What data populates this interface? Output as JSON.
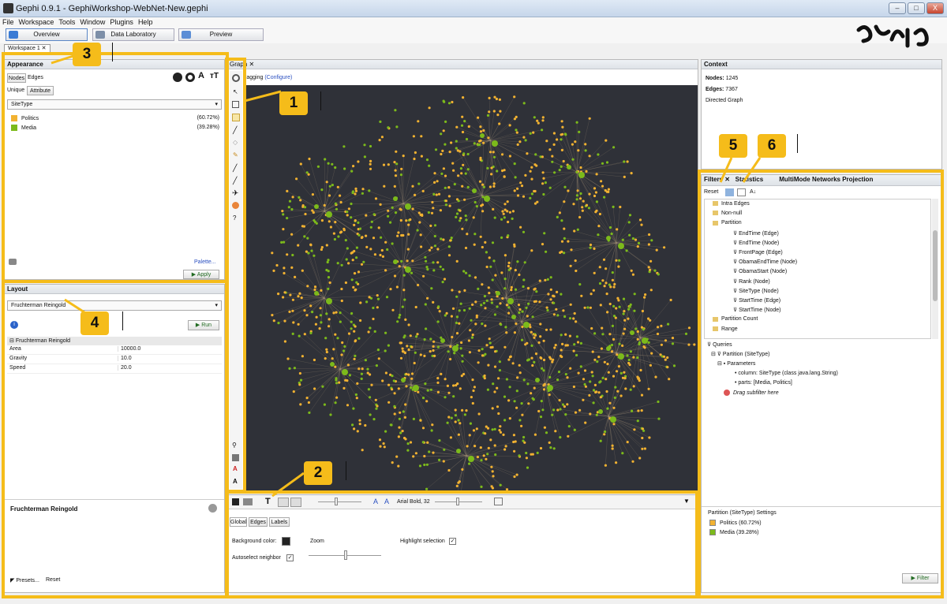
{
  "window": {
    "title": "Gephi 0.9.1 - GephiWorkshop-WebNet-New.gephi",
    "minimize": "–",
    "maximize": "□",
    "close": "X"
  },
  "menu": [
    "File",
    "Workspace",
    "Tools",
    "Window",
    "Plugins",
    "Help"
  ],
  "toolbar": {
    "overview": "Overview",
    "data_lab": "Data Laboratory",
    "preview": "Preview",
    "workspace": "Workspace 1"
  },
  "colors": {
    "highlight": "#f5bc1a",
    "politics": "#f2b231",
    "media": "#7cba1b",
    "graph_bg": "#2f3138"
  },
  "appearance": {
    "title": "Appearance",
    "tab_nodes": "Nodes",
    "tab_edges": "Edges",
    "sub_unique": "Unique",
    "sub_attr": "Attribute",
    "select": "SiteType",
    "items": [
      {
        "label": "Politics",
        "pct": "(60.72%)",
        "color": "#f2b231"
      },
      {
        "label": "Media",
        "pct": "(39.28%)",
        "color": "#7cba1b"
      }
    ],
    "palette": "Palette...",
    "apply": "Apply",
    "icon_text": "A",
    "icon_size": "тT"
  },
  "layout": {
    "title": "Layout",
    "algorithm": "Fruchterman Reingold",
    "run": "Run",
    "group": "Fruchterman Reingold",
    "props": [
      {
        "name": "Area",
        "value": "10000.0"
      },
      {
        "name": "Gravity",
        "value": "10.0"
      },
      {
        "name": "Speed",
        "value": "20.0"
      }
    ],
    "desc_title": "Fruchterman Reingold",
    "presets": "Presets...",
    "reset": "Reset"
  },
  "graph": {
    "tab": "Graph",
    "mode_prefix": "ragging",
    "configure": "(Configure)"
  },
  "bottom": {
    "font": "Arial Bold, 32",
    "tabs": [
      "Global",
      "Edges",
      "Labels"
    ],
    "bg_color": "Background color:",
    "zoom": "Zoom",
    "highlight": "Highlight selection",
    "autoselect": "Autoselect neighbor"
  },
  "context": {
    "title": "Context",
    "nodes_label": "Nodes:",
    "nodes": "1245",
    "edges_label": "Edges:",
    "edges": "7367",
    "type": "Directed Graph"
  },
  "filters": {
    "tab_filters": "Filters",
    "tab_stats": "Statistics",
    "tab_mm": "MultiMode Networks Projection",
    "reset": "Reset",
    "tree": [
      {
        "t": "Intra Edges",
        "lvl": 1
      },
      {
        "t": "Non-null",
        "lvl": 1
      },
      {
        "t": "Partition",
        "lvl": 1
      },
      {
        "t": "EndTime (Edge)",
        "lvl": 2
      },
      {
        "t": "EndTime (Node)",
        "lvl": 2
      },
      {
        "t": "FrontPage (Edge)",
        "lvl": 2
      },
      {
        "t": "ObamaEndTime (Node)",
        "lvl": 2
      },
      {
        "t": "ObamaStart (Node)",
        "lvl": 2
      },
      {
        "t": "Rank (Node)",
        "lvl": 2
      },
      {
        "t": "SiteType (Node)",
        "lvl": 2
      },
      {
        "t": "StartTime (Edge)",
        "lvl": 2
      },
      {
        "t": "StartTime (Node)",
        "lvl": 2
      },
      {
        "t": "Partition Count",
        "lvl": 1
      },
      {
        "t": "Range",
        "lvl": 1
      }
    ],
    "queries": "Queries",
    "query": "Partition (SiteType)",
    "params": "Parameters",
    "p1": "column: SiteType (class java.lang.String)",
    "p2": "parts: [Media, Politics]",
    "drag": "Drag subfilter here",
    "settings": "Partition (SiteType) Settings",
    "s1": "Politics (60.72%)",
    "s2": "Media (39.28%)",
    "filter_btn": "Filter"
  },
  "badges": [
    "1",
    "2",
    "3",
    "4",
    "5",
    "6"
  ]
}
